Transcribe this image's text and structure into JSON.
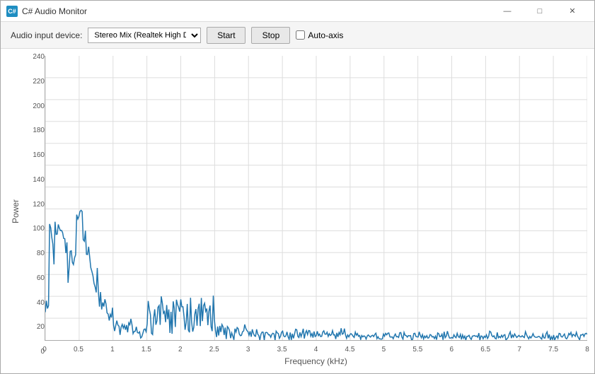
{
  "window": {
    "title": "C# Audio Monitor",
    "icon_label": "C#"
  },
  "title_controls": {
    "minimize": "—",
    "maximize": "□",
    "close": "✕"
  },
  "toolbar": {
    "device_label": "Audio input device:",
    "device_value": "Stereo Mix (Realtek High Defi",
    "start_label": "Start",
    "stop_label": "Stop",
    "auto_axis_label": "Auto-axis"
  },
  "chart": {
    "y_axis_label": "Power",
    "x_axis_label": "Frequency (kHz)",
    "y_ticks": [
      0,
      20,
      40,
      60,
      80,
      100,
      120,
      140,
      160,
      180,
      200,
      220,
      240
    ],
    "x_ticks": [
      0,
      0.5,
      1,
      1.5,
      2,
      2.5,
      3,
      3.5,
      4,
      4.5,
      5,
      5.5,
      6,
      6.5,
      7,
      7.5,
      8
    ],
    "line_color": "#2176ae"
  }
}
